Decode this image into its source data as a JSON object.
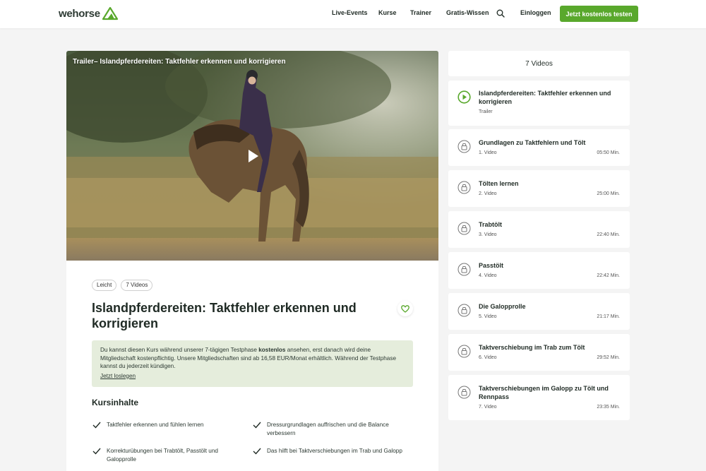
{
  "header": {
    "logo_text": "wehorse",
    "nav": [
      "Live-Events",
      "Kurse",
      "Trainer",
      "Gratis-Wissen"
    ],
    "login": "Einloggen",
    "cta": "Jetzt kostenlos testen"
  },
  "colors": {
    "accent": "#59a82c",
    "info_bg": "#e5eddc",
    "text": "#1f2a24"
  },
  "video": {
    "title": "Trailer– Islandpferdereiten: Taktfehler erkennen und korrigieren"
  },
  "course": {
    "tags": [
      "Leicht",
      "7 Videos"
    ],
    "title": "Islandpferdereiten: Taktfehler erkennen und korrigieren",
    "info_pre": "Du kannst diesen Kurs während unserer 7-tägigen Testphase ",
    "info_bold": "kostenlos",
    "info_post": " ansehen, erst danach wird deine Mitgliedschaft kostenpflichtig. Unsere Mitgliedschaften sind ab 16,58 EUR/Monat erhältlich. Während der Testphase kannst du jederzeit kündigen.",
    "info_link": "Jetzt loslegen",
    "section_title": "Kursinhalte",
    "bullets": [
      "Taktfehler erkennen und fühlen lernen",
      "Dressurgrundlagen auffrischen und die Balance verbessern",
      "Korrekturübungen bei Trabtölt, Passtölt und Galopprolle",
      "Das hilft bei Taktverschiebungen im Trab und Galopp"
    ]
  },
  "sidebar": {
    "header": "7 Videos",
    "items": [
      {
        "title": "Islandpferdereiten: Taktfehler erkennen und korrigieren",
        "sub": "Trailer",
        "duration": "",
        "icon": "play-icon"
      },
      {
        "title": "Grundlagen zu Taktfehlern und Tölt",
        "sub": "1. Video",
        "duration": "05:50 Min.",
        "icon": "lock-icon"
      },
      {
        "title": "Tölten lernen",
        "sub": "2. Video",
        "duration": "25:00 Min.",
        "icon": "lock-icon"
      },
      {
        "title": "Trabtölt",
        "sub": "3. Video",
        "duration": "22:40 Min.",
        "icon": "lock-icon"
      },
      {
        "title": "Passtölt",
        "sub": "4. Video",
        "duration": "22:42 Min.",
        "icon": "lock-icon"
      },
      {
        "title": "Die Galopprolle",
        "sub": "5. Video",
        "duration": "21:17 Min.",
        "icon": "lock-icon"
      },
      {
        "title": "Taktverschiebung im Trab zum Tölt",
        "sub": "6. Video",
        "duration": "29:52 Min.",
        "icon": "lock-icon"
      },
      {
        "title": "Taktverschiebungen im Galopp zu Tölt und Rennpass",
        "sub": "7. Video",
        "duration": "23:35 Min.",
        "icon": "lock-icon"
      }
    ]
  }
}
